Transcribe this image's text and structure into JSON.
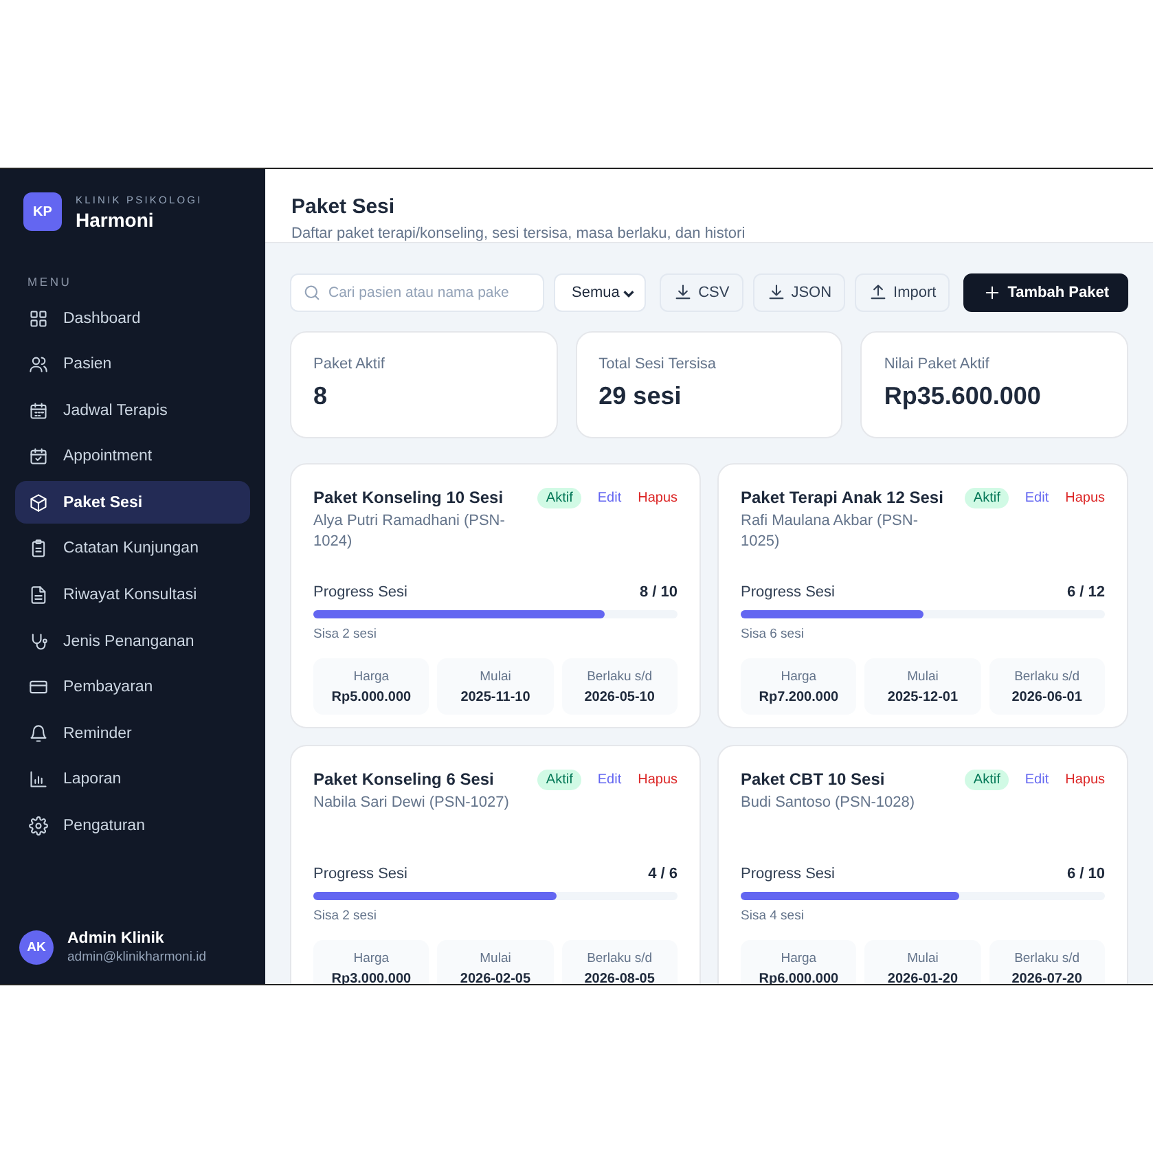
{
  "brand": {
    "logo": "KP",
    "eyebrow": "KLINIK PSIKOLOGI",
    "name": "Harmoni"
  },
  "sidebar": {
    "heading": "MENU",
    "items": [
      {
        "label": "Dashboard",
        "selected": false
      },
      {
        "label": "Pasien",
        "selected": false
      },
      {
        "label": "Jadwal Terapis",
        "selected": false
      },
      {
        "label": "Appointment",
        "selected": false
      },
      {
        "label": "Paket Sesi",
        "selected": true
      },
      {
        "label": "Catatan Kunjungan",
        "selected": false
      },
      {
        "label": "Riwayat Konsultasi",
        "selected": false
      },
      {
        "label": "Jenis Penanganan",
        "selected": false
      },
      {
        "label": "Pembayaran",
        "selected": false
      },
      {
        "label": "Reminder",
        "selected": false
      },
      {
        "label": "Laporan",
        "selected": false
      },
      {
        "label": "Pengaturan",
        "selected": false
      }
    ]
  },
  "user": {
    "initials": "AK",
    "name": "Admin Klinik",
    "email": "admin@klinikharmoni.id"
  },
  "header": {
    "title": "Paket Sesi",
    "subtitle": "Daftar paket terapi/konseling, sesi tersisa, masa berlaku, dan histori"
  },
  "toolbar": {
    "search": {
      "placeholder": "Cari pasien atau nama pake"
    },
    "filter": {
      "value": "Semua"
    },
    "buttons": [
      {
        "label": "CSV",
        "kind": "download"
      },
      {
        "label": "JSON",
        "kind": "download"
      },
      {
        "label": "Import",
        "kind": "upload"
      },
      {
        "label": "Tambah Paket",
        "kind": "primary"
      }
    ]
  },
  "stats": [
    {
      "label": "Paket Aktif",
      "value": "8"
    },
    {
      "label": "Total Sesi Tersisa",
      "value": "29 sesi"
    },
    {
      "label": "Nilai Paket Aktif",
      "value": "Rp35.600.000"
    }
  ],
  "packages": [
    {
      "title": "Paket Konseling 10 Sesi",
      "patient": "Alya Putri Ramadhani (PSN-1024)",
      "status": "Aktif",
      "edit": "Edit",
      "delete": "Hapus",
      "progress_label": "Progress Sesi",
      "progress_value": "8 / 10",
      "level": 0.8,
      "remaining": "Sisa 2 sesi",
      "details": [
        {
          "label": "Harga",
          "value": "Rp5.000.000"
        },
        {
          "label": "Mulai",
          "value": "2025-11-10"
        },
        {
          "label": "Berlaku s/d",
          "value": "2026-05-10"
        }
      ]
    },
    {
      "title": "Paket Terapi Anak 12 Sesi",
      "patient": "Rafi Maulana Akbar (PSN-1025)",
      "status": "Aktif",
      "edit": "Edit",
      "delete": "Hapus",
      "progress_label": "Progress Sesi",
      "progress_value": "6 / 12",
      "level": 0.5,
      "remaining": "Sisa 6 sesi",
      "details": [
        {
          "label": "Harga",
          "value": "Rp7.200.000"
        },
        {
          "label": "Mulai",
          "value": "2025-12-01"
        },
        {
          "label": "Berlaku s/d",
          "value": "2026-06-01"
        }
      ]
    },
    {
      "title": "Paket Konseling 6 Sesi",
      "patient": "Nabila Sari Dewi (PSN-1027)",
      "status": "Aktif",
      "edit": "Edit",
      "delete": "Hapus",
      "progress_label": "Progress Sesi",
      "progress_value": "4 / 6",
      "level": 0.667,
      "remaining": "Sisa 2 sesi",
      "details": [
        {
          "label": "Harga",
          "value": "Rp3.000.000"
        },
        {
          "label": "Mulai",
          "value": "2026-02-05"
        },
        {
          "label": "Berlaku s/d",
          "value": "2026-08-05"
        }
      ]
    },
    {
      "title": "Paket CBT 10 Sesi",
      "patient": "Budi Santoso (PSN-1028)",
      "status": "Aktif",
      "edit": "Edit",
      "delete": "Hapus",
      "progress_label": "Progress Sesi",
      "progress_value": "6 / 10",
      "level": 0.6,
      "remaining": "Sisa 4 sesi",
      "details": [
        {
          "label": "Harga",
          "value": "Rp6.000.000"
        },
        {
          "label": "Mulai",
          "value": "2026-01-20"
        },
        {
          "label": "Berlaku s/d",
          "value": "2026-07-20"
        }
      ]
    }
  ]
}
